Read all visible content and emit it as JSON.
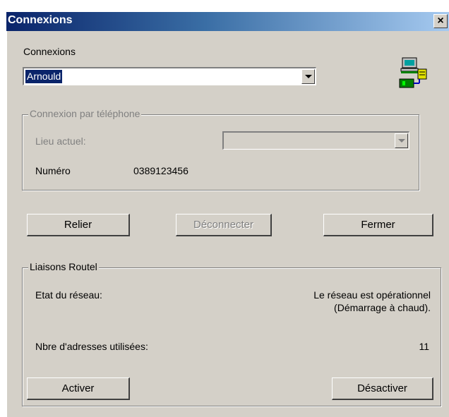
{
  "window": {
    "title": "Connexions",
    "close_glyph": "×"
  },
  "connexions": {
    "label": "Connexions",
    "selected": "Arnould"
  },
  "phone": {
    "legend": "Connexion par téléphone",
    "location_label": "Lieu actuel:",
    "location_value": "",
    "number_label": "Numéro",
    "number_value": "0389123456"
  },
  "buttons": {
    "relier": "Relier",
    "deconnecter": "Déconnecter",
    "fermer": "Fermer"
  },
  "routel": {
    "legend": "Liaisons Routel",
    "network_label": "Etat du réseau:",
    "network_status_line1": "Le réseau est opérationnel",
    "network_status_line2": "(Démarrage à chaud).",
    "addresses_label": "Nbre d'adresses utilisées:",
    "addresses_value": "11",
    "activer": "Activer",
    "desactiver": "Désactiver"
  },
  "icons": {
    "network": "network-computers-icon",
    "close": "close-icon",
    "dropdown": "chevron-down-icon"
  }
}
